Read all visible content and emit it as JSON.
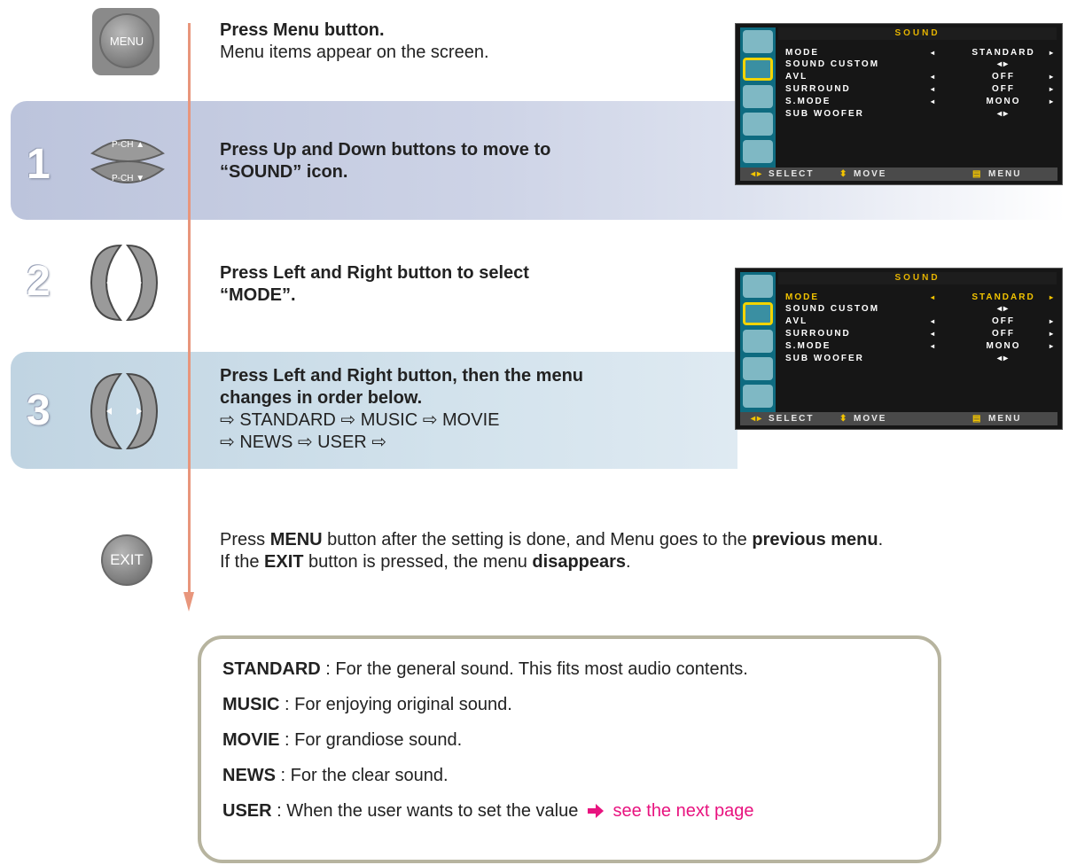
{
  "buttons": {
    "menu_label": "MENU",
    "up_label": "P-CH ▲",
    "down_label": "P-CH ▼",
    "exit_label": "EXIT"
  },
  "steps": [
    {
      "number": "",
      "title": "Press Menu button.",
      "desc": "Menu items appear on the screen."
    },
    {
      "number": "1",
      "line1": "Press Up and Down buttons to move to",
      "line2": "“SOUND” icon."
    },
    {
      "number": "2",
      "line1": "Press Left and Right button to select",
      "line2": "“MODE”."
    },
    {
      "number": "3",
      "line1": "Press Left and Right button, then the menu",
      "line2": "changes in order below.",
      "order_line1": "⇨ STANDARD ⇨ MUSIC ⇨ MOVIE",
      "order_line2": "⇨ NEWS ⇨  USER ⇨"
    }
  ],
  "exit_text": {
    "p1": "Press ",
    "b1": "MENU",
    "p2": " button after the setting is done, and Menu goes to the ",
    "b2": "previous menu",
    "p3": ".",
    "p4": "If the ",
    "b3": "EXIT",
    "p5": " button is pressed, the menu ",
    "b4": "disappears",
    "p6": "."
  },
  "osd": {
    "title": "SOUND",
    "rows": [
      {
        "label": "MODE",
        "value": "STANDARD",
        "arrows": true
      },
      {
        "label": "SOUND  CUSTOM",
        "value": "◂▸",
        "arrows": false
      },
      {
        "label": "AVL",
        "value": "OFF",
        "arrows": true
      },
      {
        "label": "SURROUND",
        "value": "OFF",
        "arrows": true
      },
      {
        "label": "S.MODE",
        "value": "MONO",
        "arrows": true
      },
      {
        "label": "SUB  WOOFER",
        "value": "◂▸",
        "arrows": false
      }
    ],
    "footer": {
      "select": "SELECT",
      "move": "MOVE",
      "menu": "MENU"
    },
    "highlight_color": "#f2c400",
    "icon_column_color": "#0e6b80"
  },
  "modes": [
    {
      "name": "STANDARD",
      "desc": " : For the general sound. This fits most audio contents."
    },
    {
      "name": "MUSIC",
      "desc": " : For enjoying original sound."
    },
    {
      "name": "MOVIE",
      "desc": " : For grandiose sound."
    },
    {
      "name": "NEWS",
      "desc": " : For the clear sound."
    },
    {
      "name": "USER",
      "desc": " : When the user wants to set the value ",
      "link": "see the next page"
    }
  ],
  "colors": {
    "flow_line": "#e8967c",
    "link": "#e8137f",
    "box_border": "#b7b49f"
  }
}
